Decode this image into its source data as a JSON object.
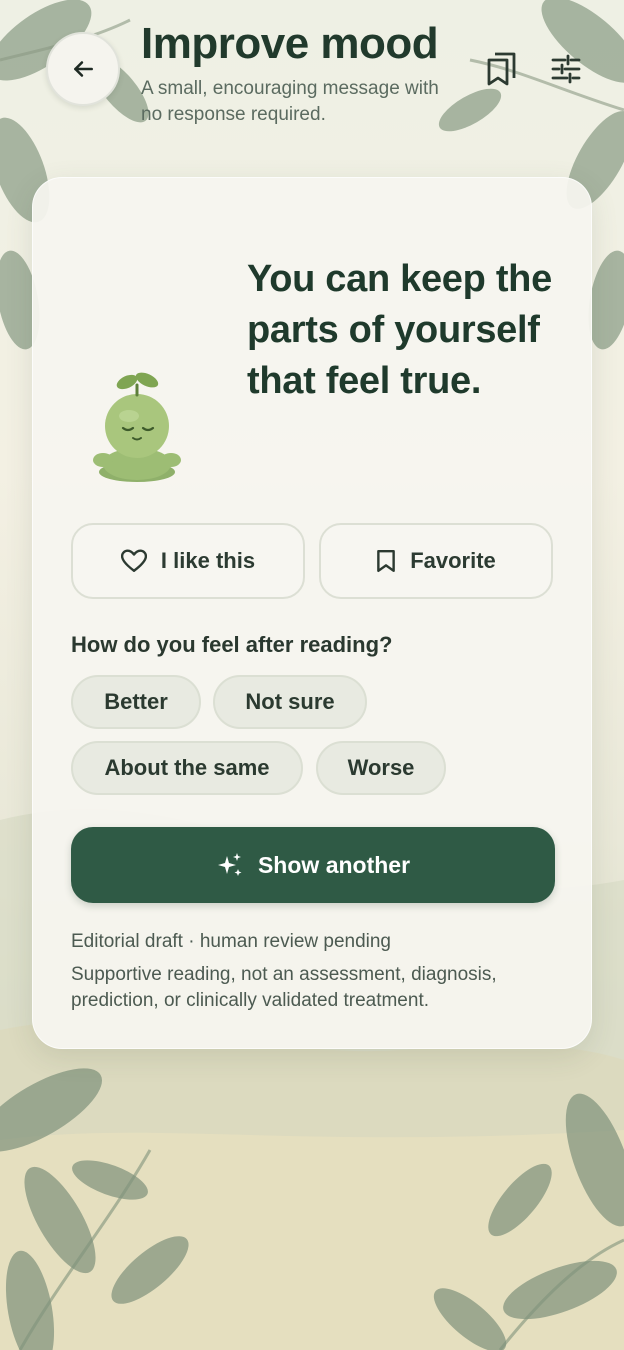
{
  "header": {
    "title": "Improve mood",
    "subtitle": "A small, encouraging message with no response required."
  },
  "card": {
    "quote": "You can keep the parts of yourself that feel true.",
    "like_label": "I like this",
    "favorite_label": "Favorite",
    "question": "How do you feel after reading?",
    "feelings": [
      "Better",
      "Not sure",
      "About the same",
      "Worse"
    ],
    "show_another_label": "Show another",
    "editorial_note": "Editorial draft · human review pending",
    "disclaimer": "Supportive reading, not an assessment, diagnosis, prediction, or clinically validated treatment."
  },
  "icons": {
    "back": "arrow-left-icon",
    "saved": "bookmarks-icon",
    "settings": "tune-icon",
    "like": "heart-icon",
    "favorite": "bookmark-icon",
    "show_another": "sparkles-icon"
  },
  "colors": {
    "primary": "#2f5a45",
    "title": "#213a2c",
    "card": "#f6f5f0",
    "chip": "#e8eae1"
  }
}
